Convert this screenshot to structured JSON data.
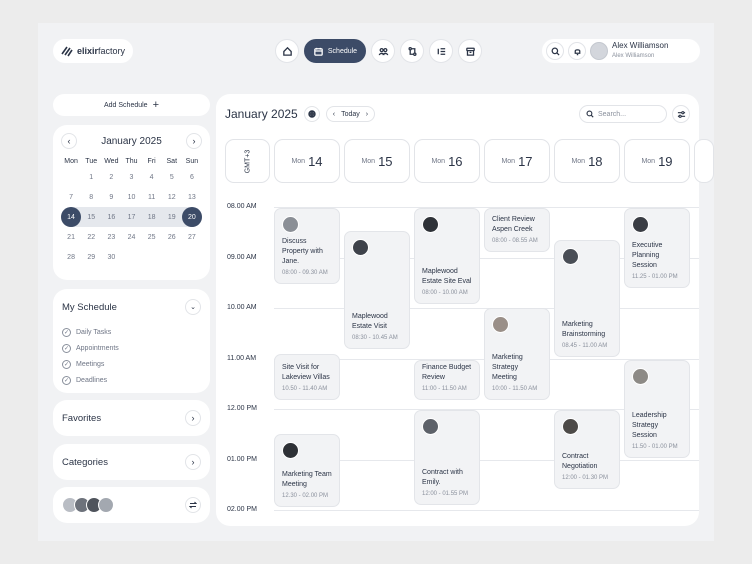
{
  "app": {
    "logo_bold": "elixir",
    "logo_rest": "factory"
  },
  "nav": {
    "schedule_label": "Schedule"
  },
  "user": {
    "name": "Alex Williamson",
    "sub": "Alex Williamson"
  },
  "sidebar": {
    "add_schedule": "Add Schedule",
    "calendar": {
      "month": "January 2025",
      "dow": [
        "Mon",
        "Tue",
        "Wed",
        "Thu",
        "Fri",
        "Sat",
        "Sun"
      ],
      "days": [
        [
          "",
          "1",
          "2",
          "3",
          "4",
          "5",
          "6"
        ],
        [
          "7",
          "8",
          "9",
          "10",
          "11",
          "12",
          "13"
        ],
        [
          "14",
          "15",
          "16",
          "17",
          "18",
          "19",
          "20"
        ],
        [
          "21",
          "22",
          "23",
          "24",
          "25",
          "26",
          "27"
        ],
        [
          "28",
          "29",
          "30",
          "",
          "",
          "",
          ""
        ]
      ]
    },
    "my_schedule": {
      "title": "My Schedule",
      "items": [
        "Daily Tasks",
        "Appointments",
        "Meetings",
        "Deadlines"
      ]
    },
    "favorites": "Favorites",
    "categories": "Categories"
  },
  "main": {
    "title": "January 2025",
    "today": "Today",
    "search_placeholder": "Search...",
    "gmt": "GMT+3",
    "days": [
      {
        "label": "Mon",
        "num": "14"
      },
      {
        "label": "Mon",
        "num": "15"
      },
      {
        "label": "Mon",
        "num": "16"
      },
      {
        "label": "Mon",
        "num": "17"
      },
      {
        "label": "Mon",
        "num": "18"
      },
      {
        "label": "Mon",
        "num": "19"
      }
    ],
    "times": [
      "08.00 AM",
      "09.00 AM",
      "10.00 AM",
      "11.00 AM",
      "12.00 PM",
      "01.00 PM",
      "02.00 PM"
    ],
    "events": [
      {
        "title": "Discuss Property with Jane.",
        "time": "08:00 - 09.30 AM"
      },
      {
        "title": "Maplewood Estate Visit",
        "time": "08:30 - 10.45 AM"
      },
      {
        "title": "Maplewood Estate Site Eval",
        "time": "08:00 - 10.00 AM"
      },
      {
        "title": "Client Review Aspen Creek",
        "time": "08:00 - 08.55 AM"
      },
      {
        "title": "Marketing Brainstorming",
        "time": "08.45 - 11.00 AM"
      },
      {
        "title": "Executive Planning Session",
        "time": "11.25 - 01.00 PM"
      },
      {
        "title": "Site Visit for Lakeview Villas",
        "time": "10.50 - 11.40 AM"
      },
      {
        "title": "Finance Budget Review",
        "time": "11:00 - 11.50 AM"
      },
      {
        "title": "Marketing Strategy Meeting",
        "time": "10:00 - 11.50 AM"
      },
      {
        "title": "Leadership Strategy Session",
        "time": "11.50 - 01.00 PM"
      },
      {
        "title": "Marketing Team Meeting",
        "time": "12.30 - 02.00 PM"
      },
      {
        "title": "Contract with Emily.",
        "time": "12:00 - 01.55 PM"
      },
      {
        "title": "Contract Negotiation",
        "time": "12:00 - 01.30 PM"
      }
    ]
  }
}
